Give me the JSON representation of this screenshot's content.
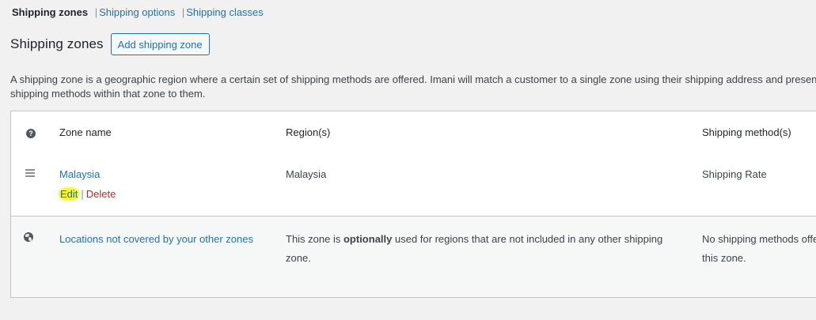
{
  "subnav": {
    "current": "Shipping zones",
    "separator": "|",
    "links": [
      "Shipping options",
      "Shipping classes"
    ]
  },
  "header": {
    "title": "Shipping zones",
    "add_button": "Add shipping zone"
  },
  "description": "A shipping zone is a geographic region where a certain set of shipping methods are offered. Imani will match a customer to a single zone using their shipping address and present the shipping methods within that zone to them.",
  "table": {
    "columns": {
      "name": "Zone name",
      "region": "Region(s)",
      "method": "Shipping method(s)"
    },
    "zones": [
      {
        "name": "Malaysia",
        "region": "Malaysia",
        "methods": "Shipping Rate",
        "actions": {
          "edit": "Edit",
          "separator": "|",
          "delete": "Delete"
        }
      }
    ],
    "rest_of_world": {
      "name": "Locations not covered by your other zones",
      "region_prefix": "This zone is ",
      "region_emphasis": "optionally",
      "region_suffix": " used for regions that are not included in any other shipping zone.",
      "methods": "No shipping methods offered to this zone."
    }
  },
  "icons": {
    "help": "help-icon",
    "drag": "drag-handle-icon",
    "globe": "globe-icon"
  },
  "colors": {
    "link": "#2271b1",
    "delete": "#b32d2e",
    "highlight": "#f5f53a"
  }
}
